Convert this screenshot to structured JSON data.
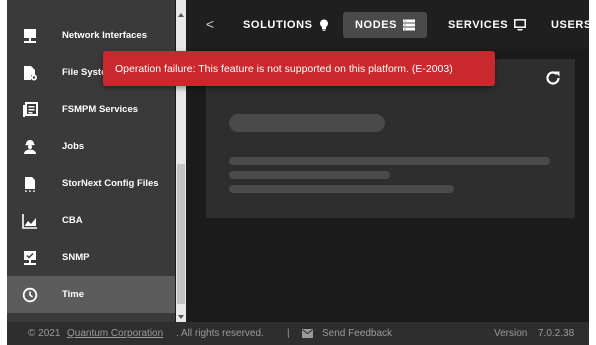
{
  "sidebar": {
    "items": [
      {
        "label": "Network Interfaces",
        "icon": "monitor-network-icon"
      },
      {
        "label": "File Systems",
        "icon": "file-settings-icon"
      },
      {
        "label": "FSMPM Services",
        "icon": "list-box-icon"
      },
      {
        "label": "Jobs",
        "icon": "worker-icon"
      },
      {
        "label": "StorNext Config Files",
        "icon": "document-icon"
      },
      {
        "label": "CBA",
        "icon": "chart-area-icon"
      },
      {
        "label": "SNMP",
        "icon": "monitor-check-icon"
      },
      {
        "label": "Time",
        "icon": "clock-icon",
        "active": true
      }
    ]
  },
  "nav": {
    "prev_symbol": "<",
    "tabs": [
      {
        "label": "SOLUTIONS",
        "icon": "lightbulb-icon",
        "active": false
      },
      {
        "label": "NODES",
        "icon": "server-icon",
        "active": true
      },
      {
        "label": "SERVICES",
        "icon": "monitor-icon",
        "active": false
      },
      {
        "label": "USERS",
        "icon": "users-icon",
        "active": false
      }
    ]
  },
  "toast": {
    "message": "Operation failure: This feature is not supported on this platform. (E-2003)",
    "color": "#c9282d"
  },
  "footer": {
    "copyright_prefix": "© 2021",
    "company_link": "Quantum Corporation",
    "rights": ". All rights reserved.",
    "separator": "|",
    "feedback": "Send Feedback",
    "version_label": "Version",
    "version_value": "7.0.2.38"
  }
}
